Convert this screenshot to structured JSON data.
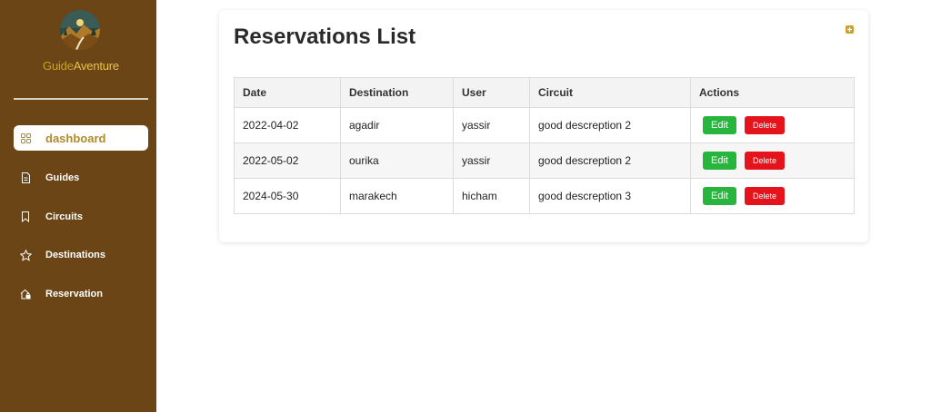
{
  "brand": {
    "part1": "Guide",
    "part2": "Aventure"
  },
  "sidebar": {
    "items": [
      {
        "label": "dashboard",
        "icon": "grid-icon"
      },
      {
        "label": "Guides",
        "icon": "document-icon"
      },
      {
        "label": "Circuits",
        "icon": "bookmark-icon"
      },
      {
        "label": "Destinations",
        "icon": "star-icon"
      },
      {
        "label": "Reservation",
        "icon": "home-lock-icon"
      }
    ]
  },
  "main": {
    "title": "Reservations List",
    "table": {
      "headers": [
        "Date",
        "Destination",
        "User",
        "Circuit",
        "Actions"
      ],
      "rows": [
        {
          "date": "2022-04-02",
          "destination": "agadir",
          "user": "yassir",
          "circuit": "good descreption 2"
        },
        {
          "date": "2022-05-02",
          "destination": "ourika",
          "user": "yassir",
          "circuit": "good descreption 2"
        },
        {
          "date": "2024-05-30",
          "destination": "marakech",
          "user": "hicham",
          "circuit": "good descreption 3"
        }
      ],
      "edit_label": "Edit",
      "delete_label": "Delete"
    }
  },
  "colors": {
    "sidebar_bg": "#6b4516",
    "accent": "#c9a227",
    "edit": "#27b53d",
    "delete": "#e5141c"
  }
}
